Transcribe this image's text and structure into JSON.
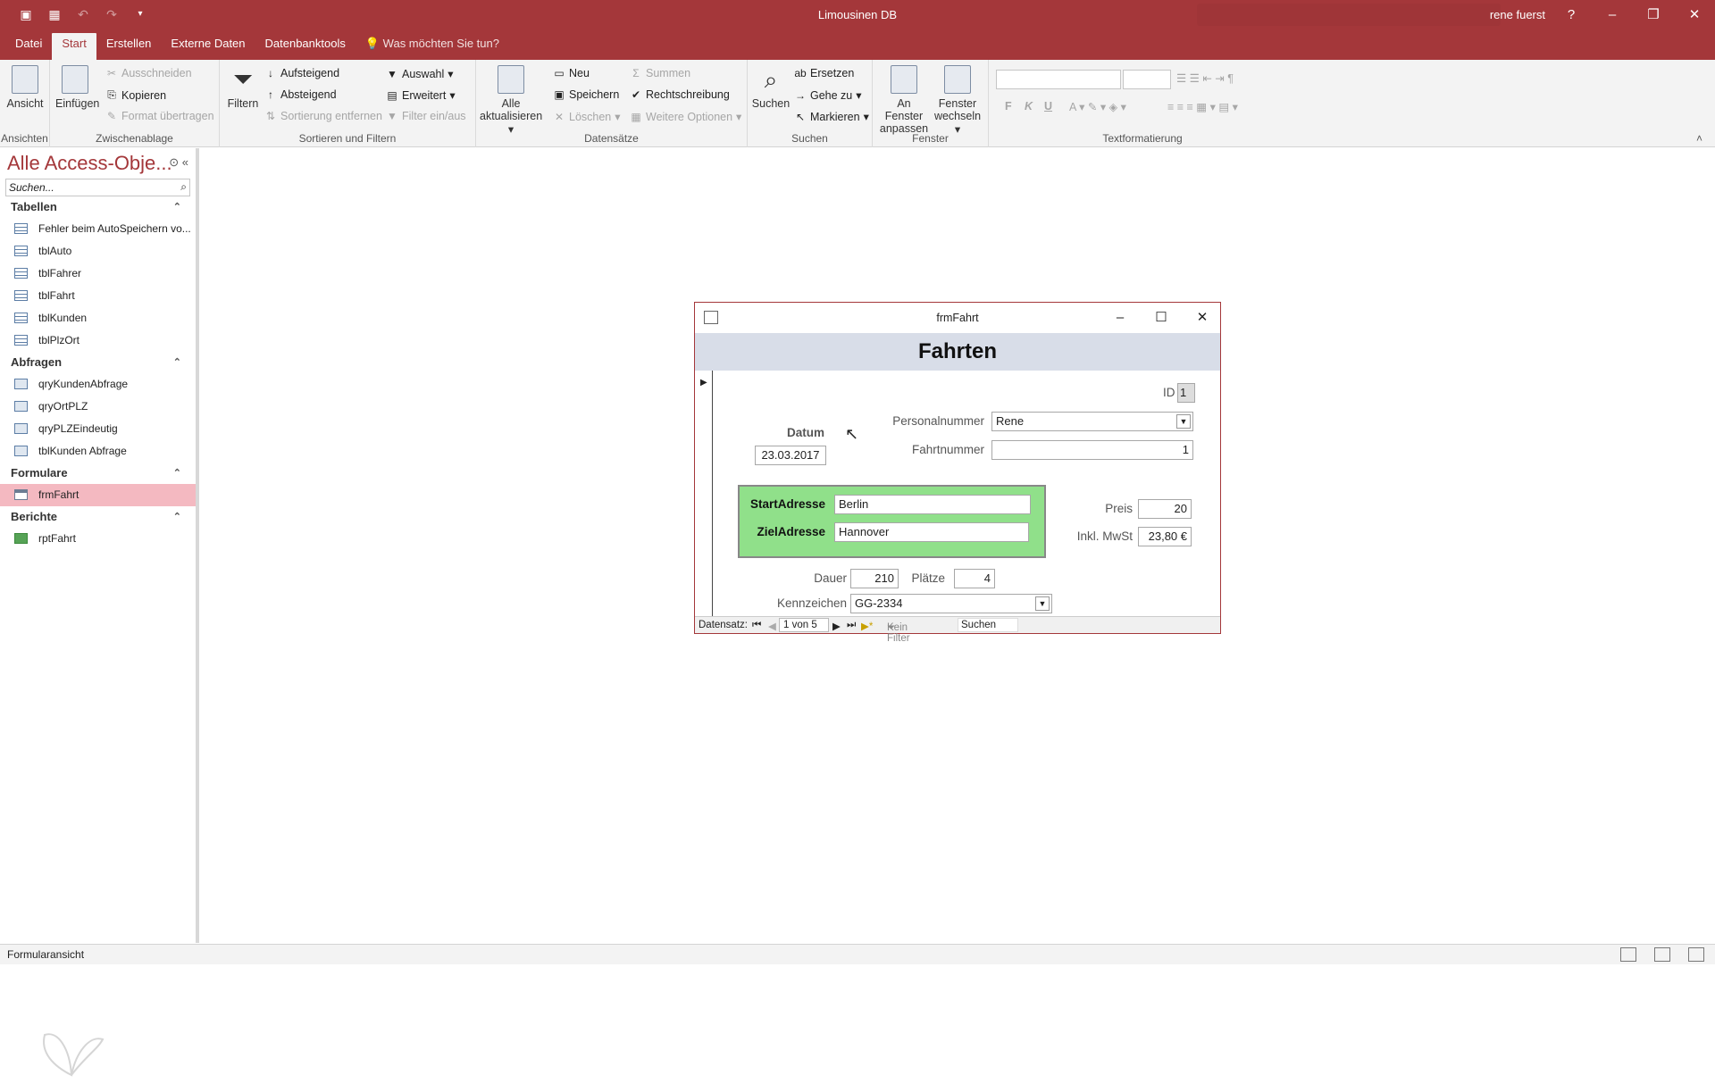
{
  "app": {
    "title": "Limousinen DB",
    "user": "rene fuerst",
    "help": "?"
  },
  "tabs": [
    "Datei",
    "Start",
    "Erstellen",
    "Externe Daten",
    "Datenbanktools"
  ],
  "tell_me": "Was möchten Sie tun?",
  "ribbon": {
    "ansichten": {
      "ansicht": "Ansicht",
      "label": "Ansichten"
    },
    "zwischenablage": {
      "einfuegen": "Einfügen",
      "ausschneiden": "Ausschneiden",
      "kopieren": "Kopieren",
      "format": "Format übertragen",
      "label": "Zwischenablage"
    },
    "sortieren": {
      "filtern": "Filtern",
      "aufsteigend": "Aufsteigend",
      "absteigend": "Absteigend",
      "sortierung": "Sortierung entfernen",
      "auswahl": "Auswahl",
      "erweitert": "Erweitert",
      "filter": "Filter ein/aus",
      "label": "Sortieren und Filtern"
    },
    "datensaetze": {
      "alle1": "Alle",
      "alle2": "aktualisieren",
      "neu": "Neu",
      "speichern": "Speichern",
      "loeschen": "Löschen",
      "summen": "Summen",
      "rechtschreibung": "Rechtschreibung",
      "weitere": "Weitere Optionen",
      "label": "Datensätze"
    },
    "suchen": {
      "suchen": "Suchen",
      "ersetzen": "Ersetzen",
      "gehezu": "Gehe zu",
      "markieren": "Markieren",
      "label": "Suchen"
    },
    "fenster": {
      "anpassen1": "An Fenster",
      "anpassen2": "anpassen",
      "wechseln1": "Fenster",
      "wechseln2": "wechseln",
      "label": "Fenster"
    },
    "text": {
      "label": "Textformatierung",
      "bold": "F",
      "italic": "K",
      "underline": "U"
    }
  },
  "nav": {
    "header": "Alle Access-Obje...",
    "search_placeholder": "Suchen...",
    "sections": {
      "tabellen": {
        "title": "Tabellen",
        "items": [
          "Fehler beim AutoSpeichern vo...",
          "tblAuto",
          "tblFahrer",
          "tblFahrt",
          "tblKunden",
          "tblPlzOrt"
        ]
      },
      "abfragen": {
        "title": "Abfragen",
        "items": [
          "qryKundenAbfrage",
          "qryOrtPLZ",
          "qryPLZEindeutig",
          "tblKunden Abfrage"
        ]
      },
      "formulare": {
        "title": "Formulare",
        "items": [
          "frmFahrt"
        ]
      },
      "berichte": {
        "title": "Berichte",
        "items": [
          "rptFahrt"
        ]
      }
    }
  },
  "status": {
    "text": "Formularansicht"
  },
  "form": {
    "window_title": "frmFahrt",
    "header": "Fahrten",
    "id_label": "ID",
    "id_value": "1",
    "datum_label": "Datum",
    "datum_value": "23.03.2017",
    "personalnummer_label": "Personalnummer",
    "personalnummer_value": "Rene",
    "fahrtnummer_label": "Fahrtnummer",
    "fahrtnummer_value": "1",
    "start_label": "StartAdresse",
    "start_value": "Berlin",
    "ziel_label": "ZielAdresse",
    "ziel_value": "Hannover",
    "preis_label": "Preis",
    "preis_value": "20",
    "mwst_label": "Inkl. MwSt",
    "mwst_value": "23,80 €",
    "dauer_label": "Dauer",
    "dauer_value": "210",
    "plaetze_label": "Plätze",
    "plaetze_value": "4",
    "kennzeichen_label": "Kennzeichen",
    "kennzeichen_value": "GG-2334",
    "nav": {
      "label": "Datensatz:",
      "position": "1 von 5",
      "filter": "Kein Filter",
      "search": "Suchen"
    }
  }
}
